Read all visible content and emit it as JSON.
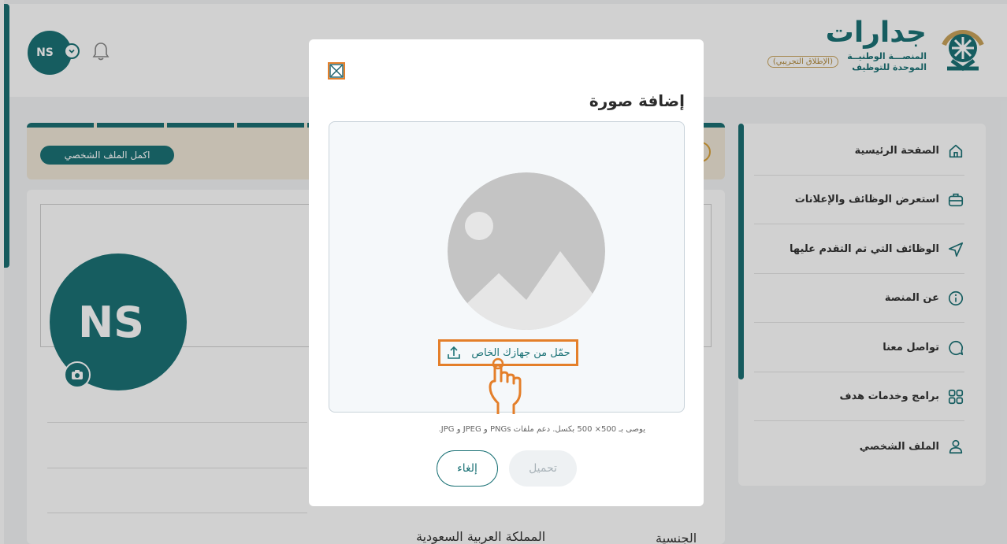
{
  "header": {
    "avatar_initials": "NS",
    "logo": {
      "title": "جدارات",
      "subtitle_line1": "المنصـــة الوطنيــة",
      "subtitle_line2": "الموحدة للتوظيف",
      "badge": "(الإطلاق التجريبي)"
    }
  },
  "profile_progress": {
    "segments_filled": 10,
    "complete_button": "اكمل الملف الشخصي"
  },
  "profile": {
    "avatar_initials": "NS",
    "nationality_label": "الجنسية",
    "nationality_value": "المملكة العربية السعودية"
  },
  "sidebar": {
    "items": [
      {
        "label": "الصفحة الرئيسية",
        "icon": "home-icon"
      },
      {
        "label": "استعرض الوظائف والإعلانات",
        "icon": "briefcase-icon"
      },
      {
        "label": "الوظائف التي تم التقدم عليها",
        "icon": "send-icon"
      },
      {
        "label": "عن المنصة",
        "icon": "info-icon"
      },
      {
        "label": "تواصل معنا",
        "icon": "chat-icon"
      },
      {
        "label": "برامج وخدمات هدف",
        "icon": "grid-icon"
      },
      {
        "label": "الملف الشخصي",
        "icon": "user-icon"
      }
    ]
  },
  "modal": {
    "title": "إضافة صورة",
    "upload_link": "حمّل من جهازك الخاص",
    "hint": "يوصى بـ 500× 500 بكسل. دعم ملفات PNGs و JPEG و JPG.",
    "cancel_label": "إلغاء",
    "upload_label": "تحميل"
  },
  "colors": {
    "brand": "#1b7276",
    "highlight": "#e47f2a",
    "accent_gold": "#c9a35b"
  }
}
